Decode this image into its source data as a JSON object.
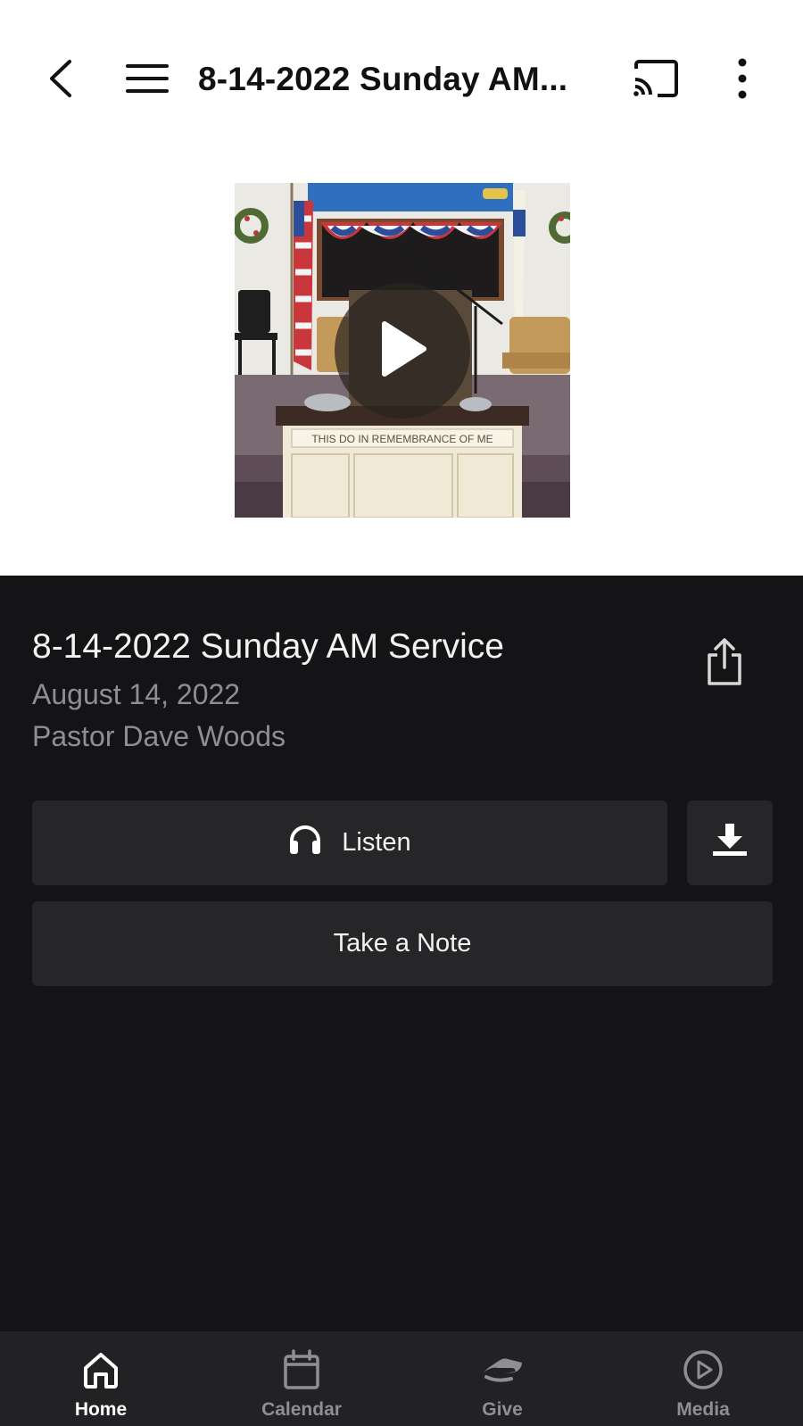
{
  "header": {
    "title": "8-14-2022 Sunday AM...",
    "icons": [
      "chevron-left-icon",
      "hamburger-menu-icon",
      "cast-icon",
      "more-vertical-icon"
    ]
  },
  "media": {
    "thumbnail_caption": "THIS DO IN REMEMBRANCE OF ME",
    "play_icon": "play-icon"
  },
  "service": {
    "title": "8-14-2022 Sunday AM Service",
    "date": "August 14, 2022",
    "speaker": "Pastor Dave Woods"
  },
  "actions": {
    "listen_label": "Listen",
    "note_label": "Take a Note",
    "listen_icon": "headphones-icon",
    "download_icon": "download-icon",
    "share_icon": "share-icon"
  },
  "tabs": [
    {
      "label": "Home",
      "icon": "home-icon",
      "active": true
    },
    {
      "label": "Calendar",
      "icon": "calendar-icon",
      "active": false
    },
    {
      "label": "Give",
      "icon": "give-icon",
      "active": false
    },
    {
      "label": "Media",
      "icon": "media-play-icon",
      "active": false
    }
  ],
  "colors": {
    "background_dark": "#141416",
    "button_bg": "#262628",
    "tabbar_bg": "#222224",
    "text_primary": "#f2f2f2",
    "text_secondary": "#8e8e93"
  }
}
